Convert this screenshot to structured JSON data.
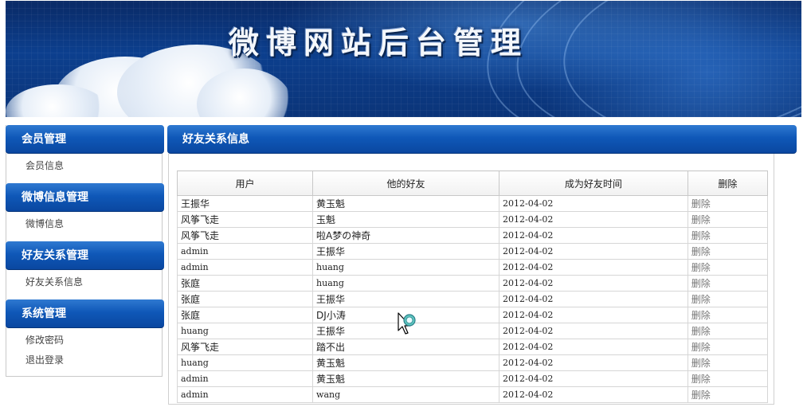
{
  "banner": {
    "title": "微博网站后台管理"
  },
  "sidebar": {
    "sections": [
      {
        "title": "会员管理",
        "links": [
          "会员信息"
        ]
      },
      {
        "title": "微博信息管理",
        "links": [
          "微博信息"
        ]
      },
      {
        "title": "好友关系管理",
        "links": [
          "好友关系信息"
        ]
      },
      {
        "title": "系统管理",
        "links": [
          "修改密码",
          "退出登录"
        ]
      }
    ]
  },
  "main": {
    "title": "好友关系信息",
    "table": {
      "headers": [
        "用户",
        "他的好友",
        "成为好友时间",
        "删除"
      ],
      "rows": [
        {
          "user": "王振华",
          "friend": "黄玉魁",
          "time": "2012-04-02",
          "action": "删除"
        },
        {
          "user": "风筝飞走",
          "friend": "玉魁",
          "time": "2012-04-02",
          "action": "删除"
        },
        {
          "user": "风筝飞走",
          "friend": "啦A梦の神奇",
          "time": "2012-04-02",
          "action": "删除"
        },
        {
          "user": "admin",
          "friend": "王振华",
          "time": "2012-04-02",
          "action": "删除"
        },
        {
          "user": "admin",
          "friend": "huang",
          "time": "2012-04-02",
          "action": "删除"
        },
        {
          "user": "张庭",
          "friend": "huang",
          "time": "2012-04-02",
          "action": "删除"
        },
        {
          "user": "张庭",
          "friend": "王振华",
          "time": "2012-04-02",
          "action": "删除"
        },
        {
          "user": "张庭",
          "friend": "DJ小涛",
          "time": "2012-04-02",
          "action": "删除"
        },
        {
          "user": "huang",
          "friend": "王振华",
          "time": "2012-04-02",
          "action": "删除"
        },
        {
          "user": "风筝飞走",
          "friend": "踏不出",
          "time": "2012-04-02",
          "action": "删除"
        },
        {
          "user": "huang",
          "friend": "黄玉魁",
          "time": "2012-04-02",
          "action": "删除"
        },
        {
          "user": "admin",
          "friend": "黄玉魁",
          "time": "2012-04-02",
          "action": "删除"
        },
        {
          "user": "admin",
          "friend": "wang",
          "time": "2012-04-02",
          "action": "删除"
        }
      ]
    }
  },
  "colors": {
    "header_blue": "#0f58b8",
    "banner_dark": "#0a2a66"
  },
  "cursor": {
    "icon": "busy-arrow-cursor-icon"
  }
}
